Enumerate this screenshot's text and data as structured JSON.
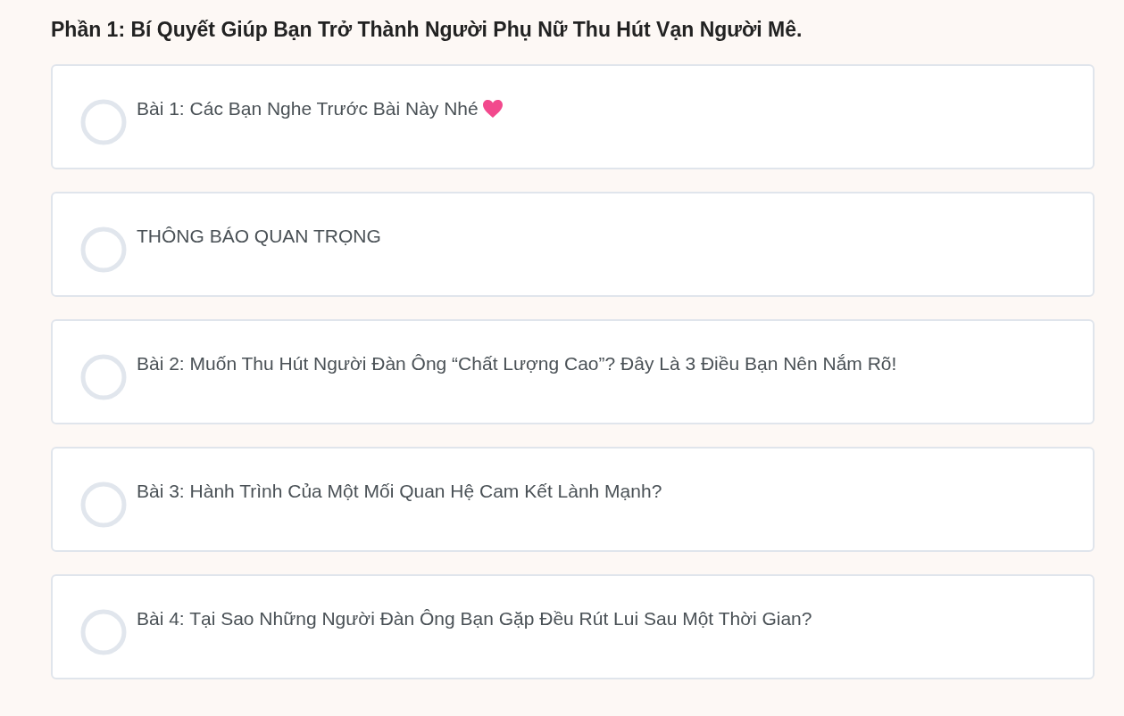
{
  "section": {
    "title": "Phần 1: Bí Quyết Giúp Bạn Trở Thành Người Phụ Nữ Thu Hút Vạn Người Mê."
  },
  "lessons": [
    {
      "title": "Bài 1: Các Bạn Nghe Trước Bài Này Nhé",
      "completed": false,
      "heart": true
    },
    {
      "title": "THÔNG BÁO QUAN TRỌNG",
      "completed": false,
      "heart": false
    },
    {
      "title": "Bài 2: Muốn Thu Hút Người Đàn Ông “Chất Lượng Cao”? Đây Là 3 Điều Bạn Nên Nắm Rõ!",
      "completed": false,
      "heart": false
    },
    {
      "title": "Bài 3: Hành Trình Của Một Mối Quan Hệ Cam Kết Lành Mạnh?",
      "completed": false,
      "heart": false
    },
    {
      "title": "Bài 4: Tại Sao Những Người Đàn Ông Bạn Gặp Đều Rút Lui Sau Một Thời Gian?",
      "completed": false,
      "heart": false
    }
  ]
}
